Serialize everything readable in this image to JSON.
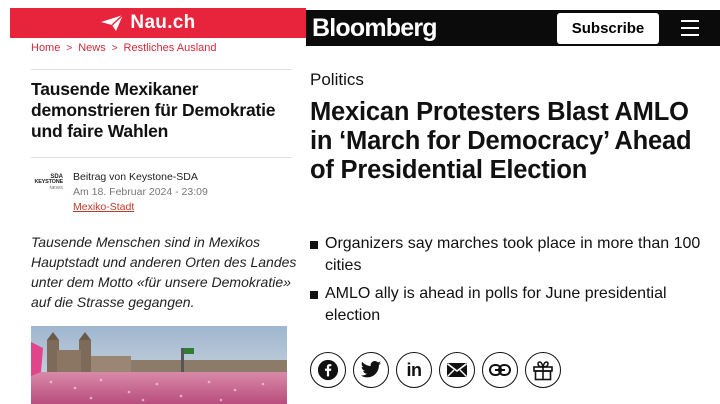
{
  "nau": {
    "logo_text": "Nau.ch",
    "breadcrumb": [
      "Home",
      "News",
      "Restliches Ausland"
    ],
    "breadcrumb_sep": ">",
    "title": "Tausende Mexikaner demonstrieren für Demokratie und faire Wahlen",
    "agency_logo": {
      "line1": "SDA",
      "line2": "KEYSTONE",
      "line3": "NEWS"
    },
    "byline": "Beitrag von Keystone-SDA",
    "date": "Am 18. Februar 2024 - 23:09",
    "place": "Mexiko-Stadt",
    "lead": "Tausende Menschen sind in Mexikos Hauptstadt und anderen Orten des Landes unter dem Motto «für unsere Demokratie» auf die Strasse gegangen.",
    "accent_color": "#e8243c"
  },
  "bloomberg": {
    "logo_text": "Bloomberg",
    "subscribe_label": "Subscribe",
    "kicker": "Politics",
    "title": "Mexican Protesters Blast AMLO in ‘March for Democracy’ Ahead of Presidential Election",
    "bullets": [
      "Organizers say marches took place in more than 100 cities",
      "AMLO ally is ahead in polls for June presidential election"
    ],
    "share_icons": [
      "facebook-icon",
      "twitter-icon",
      "linkedin-icon",
      "email-icon",
      "link-icon",
      "gift-icon"
    ],
    "linkedin_label": "in"
  }
}
